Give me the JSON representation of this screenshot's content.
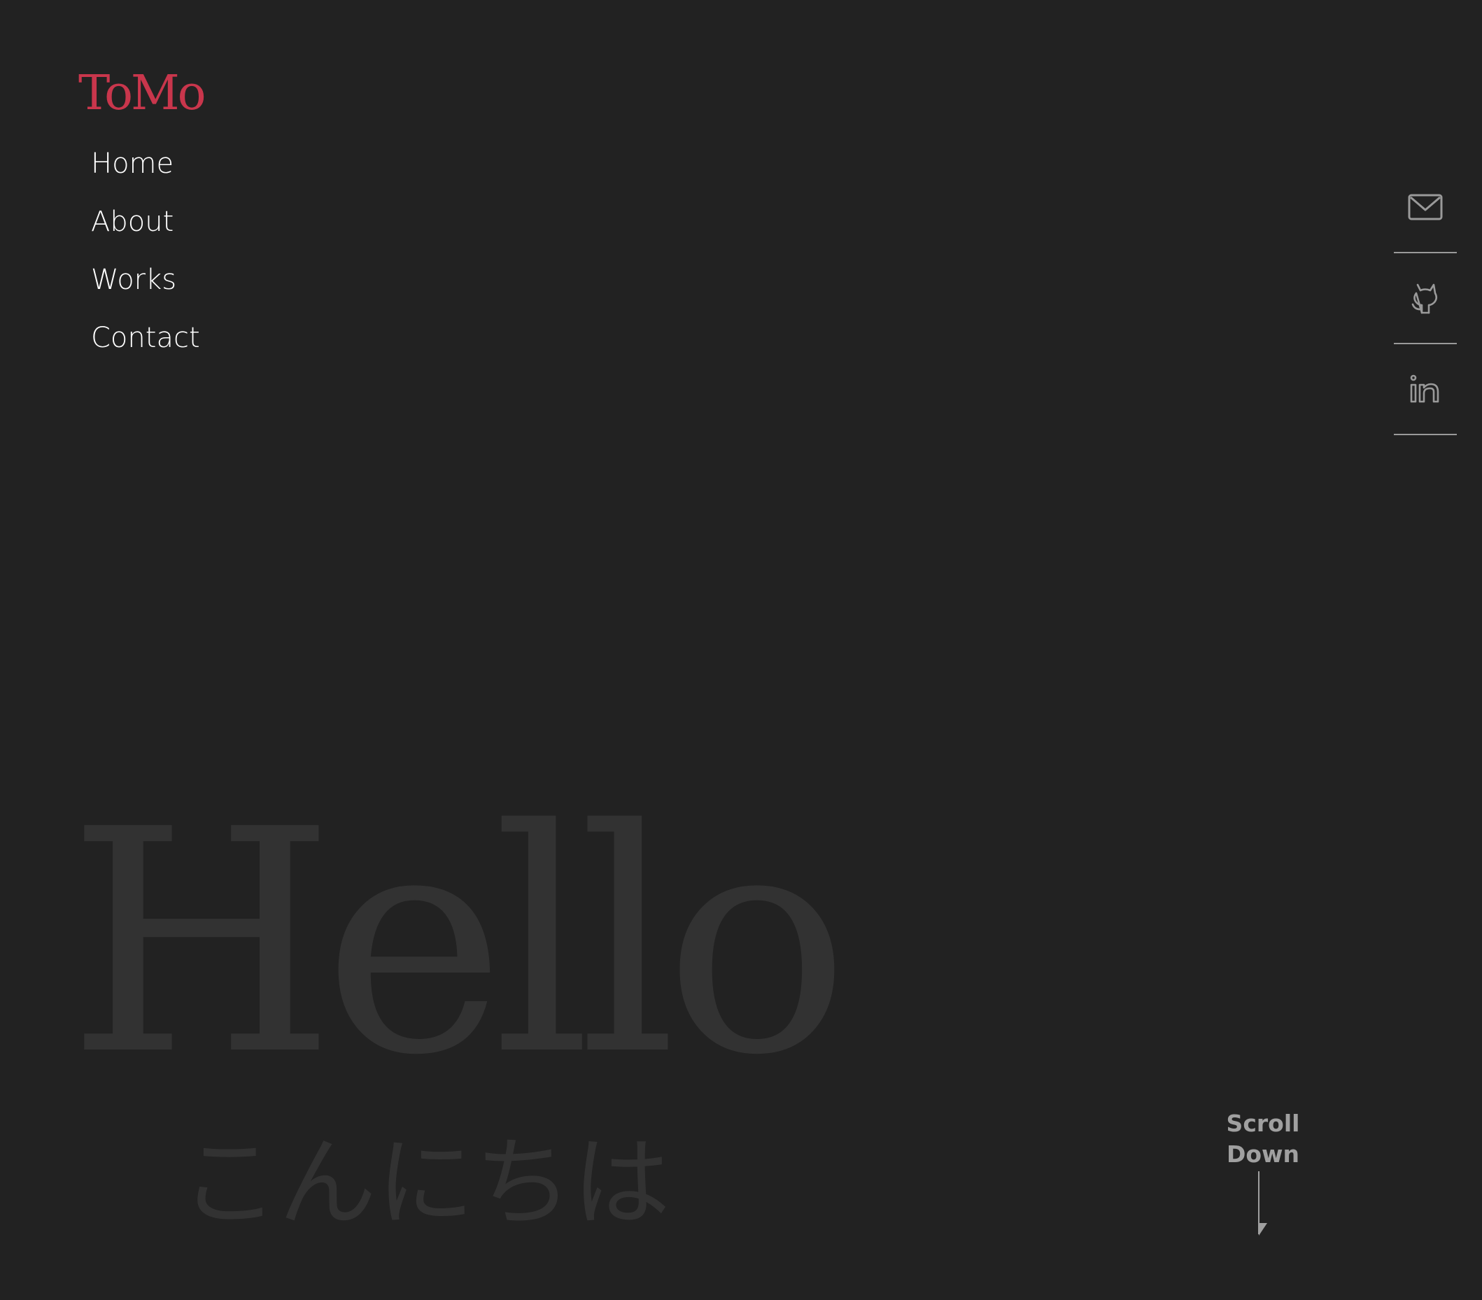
{
  "brand": {
    "logo": "ToMo",
    "accent_color": "#c9364c"
  },
  "nav": {
    "items": [
      {
        "label": "Home"
      },
      {
        "label": "About"
      },
      {
        "label": "Works"
      },
      {
        "label": "Contact"
      }
    ]
  },
  "social": {
    "icons": [
      "mail-icon",
      "github-icon",
      "linkedin-icon"
    ]
  },
  "hero": {
    "title": "Hello",
    "subtitle": "こんにちは"
  },
  "scroll": {
    "label": "Scroll Down",
    "icon": "down-arrow-icon"
  },
  "colors": {
    "background": "#222222",
    "nav_text": "#ffffff",
    "hero_text": "#323232",
    "muted": "#a0a0a0"
  }
}
